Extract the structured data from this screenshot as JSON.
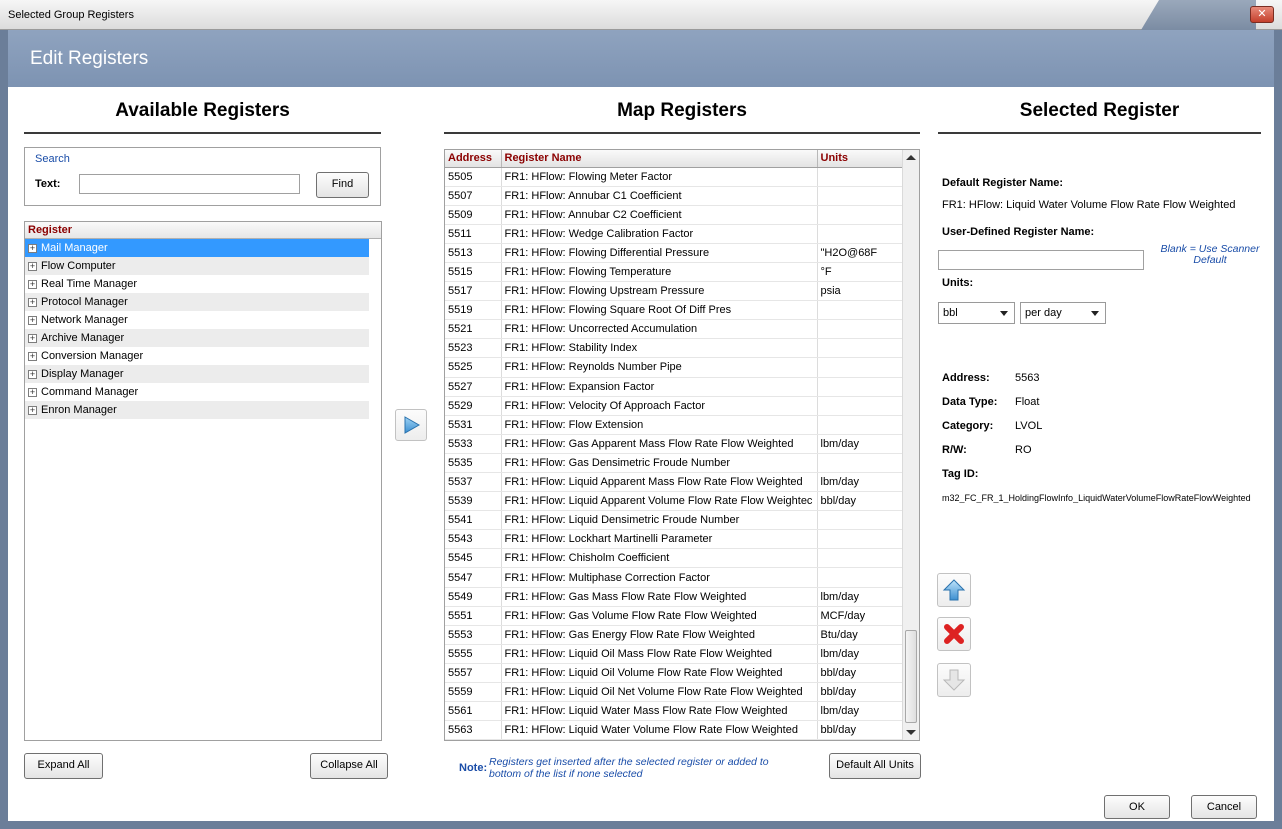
{
  "window": {
    "title": "Selected Group Registers"
  },
  "header": {
    "title": "Edit Registers"
  },
  "available": {
    "title": "Available Registers",
    "search_label": "Search",
    "text_label": "Text:",
    "search_value": "",
    "find_label": "Find",
    "tree_header": "Register",
    "tree_items": [
      {
        "label": "Mail Manager"
      },
      {
        "label": "Flow Computer"
      },
      {
        "label": "Real Time Manager"
      },
      {
        "label": "Protocol Manager"
      },
      {
        "label": "Network Manager"
      },
      {
        "label": "Archive Manager"
      },
      {
        "label": "Conversion Manager"
      },
      {
        "label": "Display Manager"
      },
      {
        "label": "Command Manager"
      },
      {
        "label": "Enron Manager"
      }
    ],
    "selected_index": 0,
    "expand_all_label": "Expand All",
    "collapse_all_label": "Collapse All"
  },
  "map": {
    "title": "Map Registers",
    "columns": [
      "Address",
      "Register Name",
      "Units"
    ],
    "rows": [
      {
        "address": "5505",
        "name": "FR1: HFlow: Flowing Meter Factor",
        "units": ""
      },
      {
        "address": "5507",
        "name": "FR1: HFlow: Annubar C1 Coefficient",
        "units": ""
      },
      {
        "address": "5509",
        "name": "FR1: HFlow: Annubar C2 Coefficient",
        "units": ""
      },
      {
        "address": "5511",
        "name": "FR1: HFlow: Wedge Calibration Factor",
        "units": ""
      },
      {
        "address": "5513",
        "name": "FR1: HFlow: Flowing Differential Pressure",
        "units": "\"H2O@68F"
      },
      {
        "address": "5515",
        "name": "FR1: HFlow: Flowing Temperature",
        "units": "°F"
      },
      {
        "address": "5517",
        "name": "FR1: HFlow: Flowing Upstream Pressure",
        "units": "psia"
      },
      {
        "address": "5519",
        "name": "FR1: HFlow: Flowing Square Root Of Diff Pres",
        "units": ""
      },
      {
        "address": "5521",
        "name": "FR1: HFlow: Uncorrected Accumulation",
        "units": ""
      },
      {
        "address": "5523",
        "name": "FR1: HFlow: Stability Index",
        "units": ""
      },
      {
        "address": "5525",
        "name": "FR1: HFlow: Reynolds Number Pipe",
        "units": ""
      },
      {
        "address": "5527",
        "name": "FR1: HFlow: Expansion Factor",
        "units": ""
      },
      {
        "address": "5529",
        "name": "FR1: HFlow: Velocity Of Approach Factor",
        "units": ""
      },
      {
        "address": "5531",
        "name": "FR1: HFlow: Flow Extension",
        "units": ""
      },
      {
        "address": "5533",
        "name": "FR1: HFlow: Gas Apparent Mass Flow Rate Flow Weighted",
        "units": "lbm/day"
      },
      {
        "address": "5535",
        "name": "FR1: HFlow: Gas Densimetric Froude Number",
        "units": ""
      },
      {
        "address": "5537",
        "name": "FR1: HFlow: Liquid Apparent Mass Flow Rate Flow Weighted",
        "units": "lbm/day"
      },
      {
        "address": "5539",
        "name": "FR1: HFlow: Liquid Apparent Volume Flow Rate Flow Weightec",
        "units": "bbl/day"
      },
      {
        "address": "5541",
        "name": "FR1: HFlow: Liquid Densimetric Froude Number",
        "units": ""
      },
      {
        "address": "5543",
        "name": "FR1: HFlow: Lockhart Martinelli Parameter",
        "units": ""
      },
      {
        "address": "5545",
        "name": "FR1: HFlow: Chisholm Coefficient",
        "units": ""
      },
      {
        "address": "5547",
        "name": "FR1: HFlow: Multiphase Correction Factor",
        "units": ""
      },
      {
        "address": "5549",
        "name": "FR1: HFlow: Gas Mass Flow Rate Flow Weighted",
        "units": "lbm/day"
      },
      {
        "address": "5551",
        "name": "FR1: HFlow: Gas Volume Flow Rate Flow Weighted",
        "units": "MCF/day"
      },
      {
        "address": "5553",
        "name": "FR1: HFlow: Gas Energy Flow Rate Flow Weighted",
        "units": "Btu/day"
      },
      {
        "address": "5555",
        "name": "FR1: HFlow: Liquid Oil Mass Flow Rate Flow Weighted",
        "units": "lbm/day"
      },
      {
        "address": "5557",
        "name": "FR1: HFlow: Liquid Oil Volume Flow Rate Flow Weighted",
        "units": "bbl/day"
      },
      {
        "address": "5559",
        "name": "FR1: HFlow: Liquid Oil Net Volume Flow Rate Flow Weighted",
        "units": "bbl/day"
      },
      {
        "address": "5561",
        "name": "FR1: HFlow: Liquid Water Mass Flow Rate Flow Weighted",
        "units": "lbm/day"
      },
      {
        "address": "5563",
        "name": "FR1: HFlow: Liquid Water Volume Flow Rate Flow Weighted",
        "units": "bbl/day"
      }
    ],
    "note_label": "Note:",
    "note_text": "Registers get inserted after the selected register or added to bottom of the list if none selected",
    "default_units_label": "Default All Units"
  },
  "selected": {
    "title": "Selected Register",
    "default_name_label": "Default Register Name:",
    "default_name_value": "FR1: HFlow: Liquid Water Volume Flow Rate Flow Weighted",
    "user_name_label": "User-Defined Register Name:",
    "user_name_value": "",
    "blank_hint": "Blank = Use Scanner Default",
    "units_label": "Units:",
    "unit_volume": "bbl",
    "unit_time": "per day",
    "address_label": "Address:",
    "address_value": "5563",
    "data_type_label": "Data Type:",
    "data_type_value": "Float",
    "category_label": "Category:",
    "category_value": "LVOL",
    "rw_label": "R/W:",
    "rw_value": "RO",
    "tag_label": "Tag ID:",
    "tag_value": "m32_FC_FR_1_HoldingFlowInfo_LiquidWaterVolumeFlowRateFlowWeighted"
  },
  "dialog": {
    "ok_label": "OK",
    "cancel_label": "Cancel"
  },
  "icons": {
    "add": "play-arrow-icon",
    "move_up": "arrow-up-icon",
    "remove": "red-x-icon",
    "move_down": "arrow-down-icon",
    "close": "close-icon"
  },
  "colors": {
    "header_bg": "#8fa3bf",
    "selected_row": "#3399ff",
    "column_header_text": "#8b0000",
    "link_blue": "#1a4da8"
  }
}
